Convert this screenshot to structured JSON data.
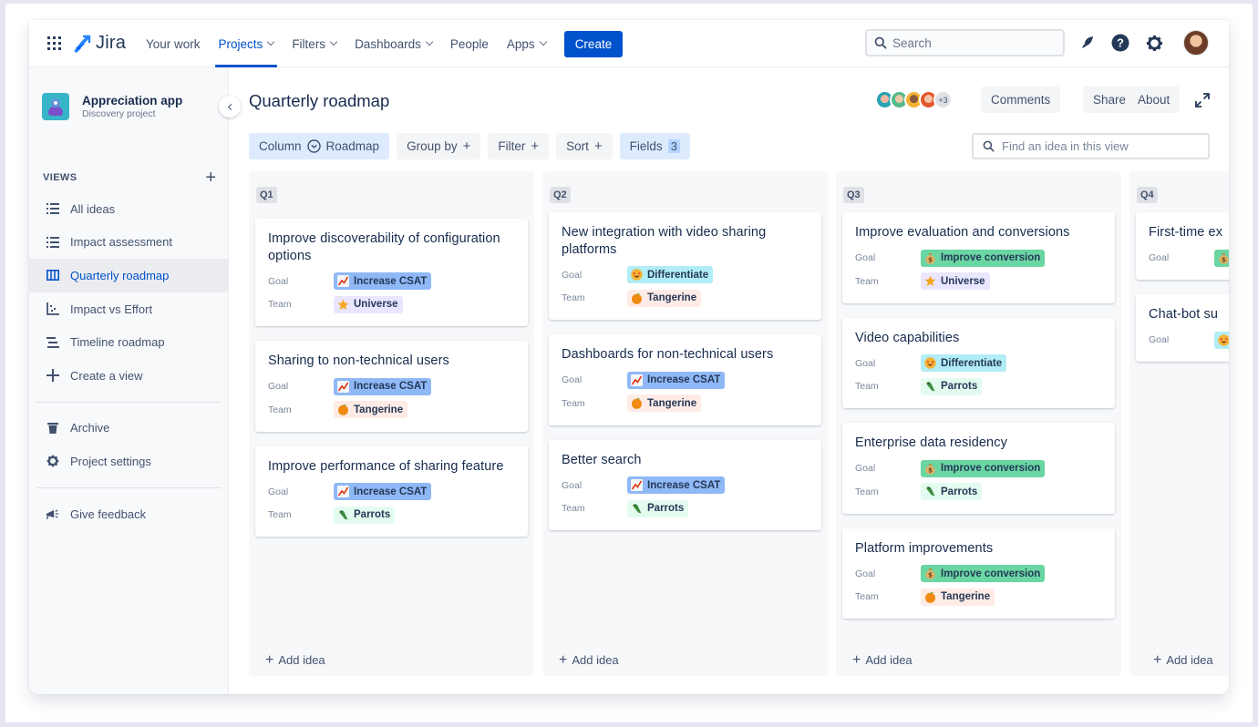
{
  "colors": {
    "brand": "#0052cc",
    "goal_csat": "#8fb8f6",
    "goal_differentiate": "#b1edf5",
    "goal_conversion": "#6ad6a2",
    "team_universe": "#eae6ff",
    "team_tangerine": "#ffebe6",
    "team_parrots": "#e3fcef"
  },
  "topnav": {
    "product": "Jira",
    "items": [
      {
        "label": "Your work",
        "dropdown": false,
        "active": false
      },
      {
        "label": "Projects",
        "dropdown": true,
        "active": true
      },
      {
        "label": "Filters",
        "dropdown": true,
        "active": false
      },
      {
        "label": "Dashboards",
        "dropdown": true,
        "active": false
      },
      {
        "label": "People",
        "dropdown": false,
        "active": false
      },
      {
        "label": "Apps",
        "dropdown": true,
        "active": false
      }
    ],
    "create_label": "Create",
    "search_placeholder": "Search",
    "icons": [
      "notifications-icon",
      "help-icon",
      "settings-icon",
      "profile-avatar"
    ]
  },
  "sidebar": {
    "project_name": "Appreciation app",
    "project_type": "Discovery project",
    "views_heading": "VIEWS",
    "views": [
      {
        "label": "All ideas",
        "icon": "list-icon",
        "active": false
      },
      {
        "label": "Impact assessment",
        "icon": "list-icon",
        "active": false
      },
      {
        "label": "Quarterly roadmap",
        "icon": "board-icon",
        "active": true
      },
      {
        "label": "Impact vs Effort",
        "icon": "matrix-icon",
        "active": false
      },
      {
        "label": "Timeline roadmap",
        "icon": "timeline-icon",
        "active": false
      },
      {
        "label": "Create a view",
        "icon": "plus-icon",
        "active": false
      }
    ],
    "secondary": [
      {
        "label": "Archive",
        "icon": "trash-icon"
      },
      {
        "label": "Project settings",
        "icon": "gear-icon"
      }
    ],
    "feedback": {
      "label": "Give feedback",
      "icon": "megaphone-icon"
    }
  },
  "header": {
    "title": "Quarterly roadmap",
    "watchers_more": "+3",
    "buttons": {
      "comments": "Comments",
      "share": "Share",
      "about": "About"
    }
  },
  "toolbar": {
    "column_label": "Column",
    "column_value": "Roadmap",
    "group_by": "Group by",
    "filter": "Filter",
    "sort": "Sort",
    "fields": "Fields",
    "fields_count": "3",
    "find_placeholder": "Find an idea in this view"
  },
  "labels": {
    "goal": "Goal",
    "team": "Team",
    "add_idea": "Add idea"
  },
  "board": {
    "columns": [
      {
        "label": "Q1",
        "cards": [
          {
            "title": "Improve discoverability of configuration options",
            "goal": "Increase CSAT",
            "goal_kind": "csat",
            "team": "Universe",
            "team_kind": "universe"
          },
          {
            "title": "Sharing to non-technical users",
            "goal": "Increase CSAT",
            "goal_kind": "csat",
            "team": "Tangerine",
            "team_kind": "tangerine"
          },
          {
            "title": "Improve performance of sharing feature",
            "goal": "Increase CSAT",
            "goal_kind": "csat",
            "team": "Parrots",
            "team_kind": "parrots"
          }
        ]
      },
      {
        "label": "Q2",
        "cards": [
          {
            "title": "New integration with video sharing platforms",
            "goal": "Differentiate",
            "goal_kind": "differentiate",
            "team": "Tangerine",
            "team_kind": "tangerine"
          },
          {
            "title": "Dashboards for non-technical users",
            "goal": "Increase CSAT",
            "goal_kind": "csat",
            "team": "Tangerine",
            "team_kind": "tangerine"
          },
          {
            "title": "Better search",
            "goal": "Increase CSAT",
            "goal_kind": "csat",
            "team": "Parrots",
            "team_kind": "parrots"
          }
        ]
      },
      {
        "label": "Q3",
        "cards": [
          {
            "title": "Improve evaluation and conversions",
            "goal": "Improve conversion",
            "goal_kind": "conversion",
            "team": "Universe",
            "team_kind": "universe"
          },
          {
            "title": "Video capabilities",
            "goal": "Differentiate",
            "goal_kind": "differentiate",
            "team": "Parrots",
            "team_kind": "parrots"
          },
          {
            "title": "Enterprise data residency",
            "goal": "Improve conversion",
            "goal_kind": "conversion",
            "team": "Parrots",
            "team_kind": "parrots"
          },
          {
            "title": "Platform improvements",
            "goal": "Improve conversion",
            "goal_kind": "conversion",
            "team": "Tangerine",
            "team_kind": "tangerine"
          }
        ]
      },
      {
        "label": "Q4",
        "cards": [
          {
            "title": "First-time ex",
            "goal_kind": "conversion",
            "truncated": true
          },
          {
            "title": "Chat-bot su",
            "goal_kind": "differentiate",
            "truncated": true
          }
        ]
      }
    ]
  }
}
